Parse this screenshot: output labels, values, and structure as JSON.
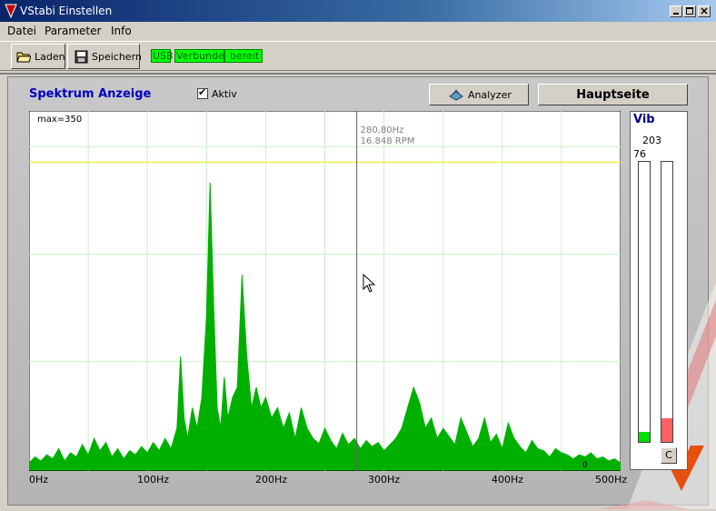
{
  "window": {
    "title": "VStabi Einstellen"
  },
  "menu": {
    "items": [
      "Datei",
      "Parameter",
      "Info"
    ]
  },
  "toolbar": {
    "load_label": "Laden",
    "save_label": "Speichern",
    "status": [
      "USB",
      "Verbunden",
      "bereit"
    ]
  },
  "panel": {
    "title": "Spektrum Anzeige",
    "aktiv_label": "Aktiv",
    "aktiv_checked": true,
    "analyzer_label": "Analyzer",
    "home_label": "Hauptseite"
  },
  "colors": {
    "spectrum_fill": "#00b000",
    "grid": "#c8f0c8",
    "max_line": "#e8e800",
    "vib_bar_left": "#00e000",
    "vib_bar_right": "#ff6060",
    "title_blue": "#0000c0"
  },
  "chart_data": {
    "type": "area",
    "max_label": "max=350",
    "ylim": [
      0,
      350
    ],
    "xlim": [
      0,
      500
    ],
    "max_line_value": 300,
    "cursor": {
      "x": 280.8,
      "freq_label": "280,80Hz",
      "rpm_label": "16.848 RPM"
    },
    "zero_label": "0",
    "x_tick_labels": [
      "0Hz",
      "100Hz",
      "200Hz",
      "300Hz",
      "400Hz",
      "500Hz"
    ],
    "x_tick_values": [
      0,
      100,
      200,
      300,
      400,
      500
    ],
    "x": [
      0,
      5,
      10,
      15,
      20,
      25,
      30,
      35,
      40,
      45,
      50,
      55,
      60,
      65,
      70,
      75,
      80,
      85,
      90,
      95,
      100,
      105,
      110,
      115,
      120,
      125,
      128,
      131,
      134,
      138,
      142,
      146,
      150,
      153,
      156,
      159,
      162,
      165,
      168,
      172,
      176,
      180,
      184,
      188,
      192,
      196,
      200,
      205,
      210,
      215,
      220,
      225,
      230,
      235,
      240,
      245,
      250,
      255,
      260,
      265,
      270,
      275,
      280,
      285,
      290,
      295,
      300,
      305,
      310,
      315,
      320,
      325,
      330,
      335,
      340,
      345,
      350,
      355,
      360,
      365,
      370,
      375,
      380,
      385,
      390,
      395,
      400,
      405,
      410,
      415,
      420,
      425,
      430,
      435,
      440,
      445,
      450,
      455,
      460,
      465,
      470,
      475,
      480,
      485,
      490,
      495,
      500
    ],
    "y": [
      6,
      12,
      8,
      14,
      10,
      20,
      8,
      16,
      12,
      24,
      14,
      30,
      18,
      26,
      12,
      20,
      10,
      18,
      14,
      22,
      16,
      26,
      18,
      30,
      20,
      40,
      110,
      50,
      30,
      60,
      40,
      70,
      150,
      280,
      160,
      60,
      40,
      90,
      50,
      70,
      80,
      190,
      110,
      60,
      80,
      60,
      70,
      50,
      60,
      40,
      55,
      30,
      60,
      40,
      30,
      25,
      40,
      28,
      20,
      35,
      24,
      30,
      20,
      28,
      22,
      26,
      18,
      24,
      30,
      40,
      60,
      80,
      65,
      40,
      50,
      30,
      40,
      32,
      24,
      50,
      36,
      22,
      30,
      50,
      26,
      34,
      20,
      45,
      30,
      22,
      16,
      28,
      20,
      18,
      12,
      20,
      16,
      14,
      10,
      14,
      12,
      16,
      10,
      12,
      8,
      10,
      6
    ]
  },
  "vib": {
    "title": "Vib",
    "left_value": "76",
    "right_value": "203",
    "left_level": 0.035,
    "right_level": 0.085,
    "clear_label": "C"
  }
}
